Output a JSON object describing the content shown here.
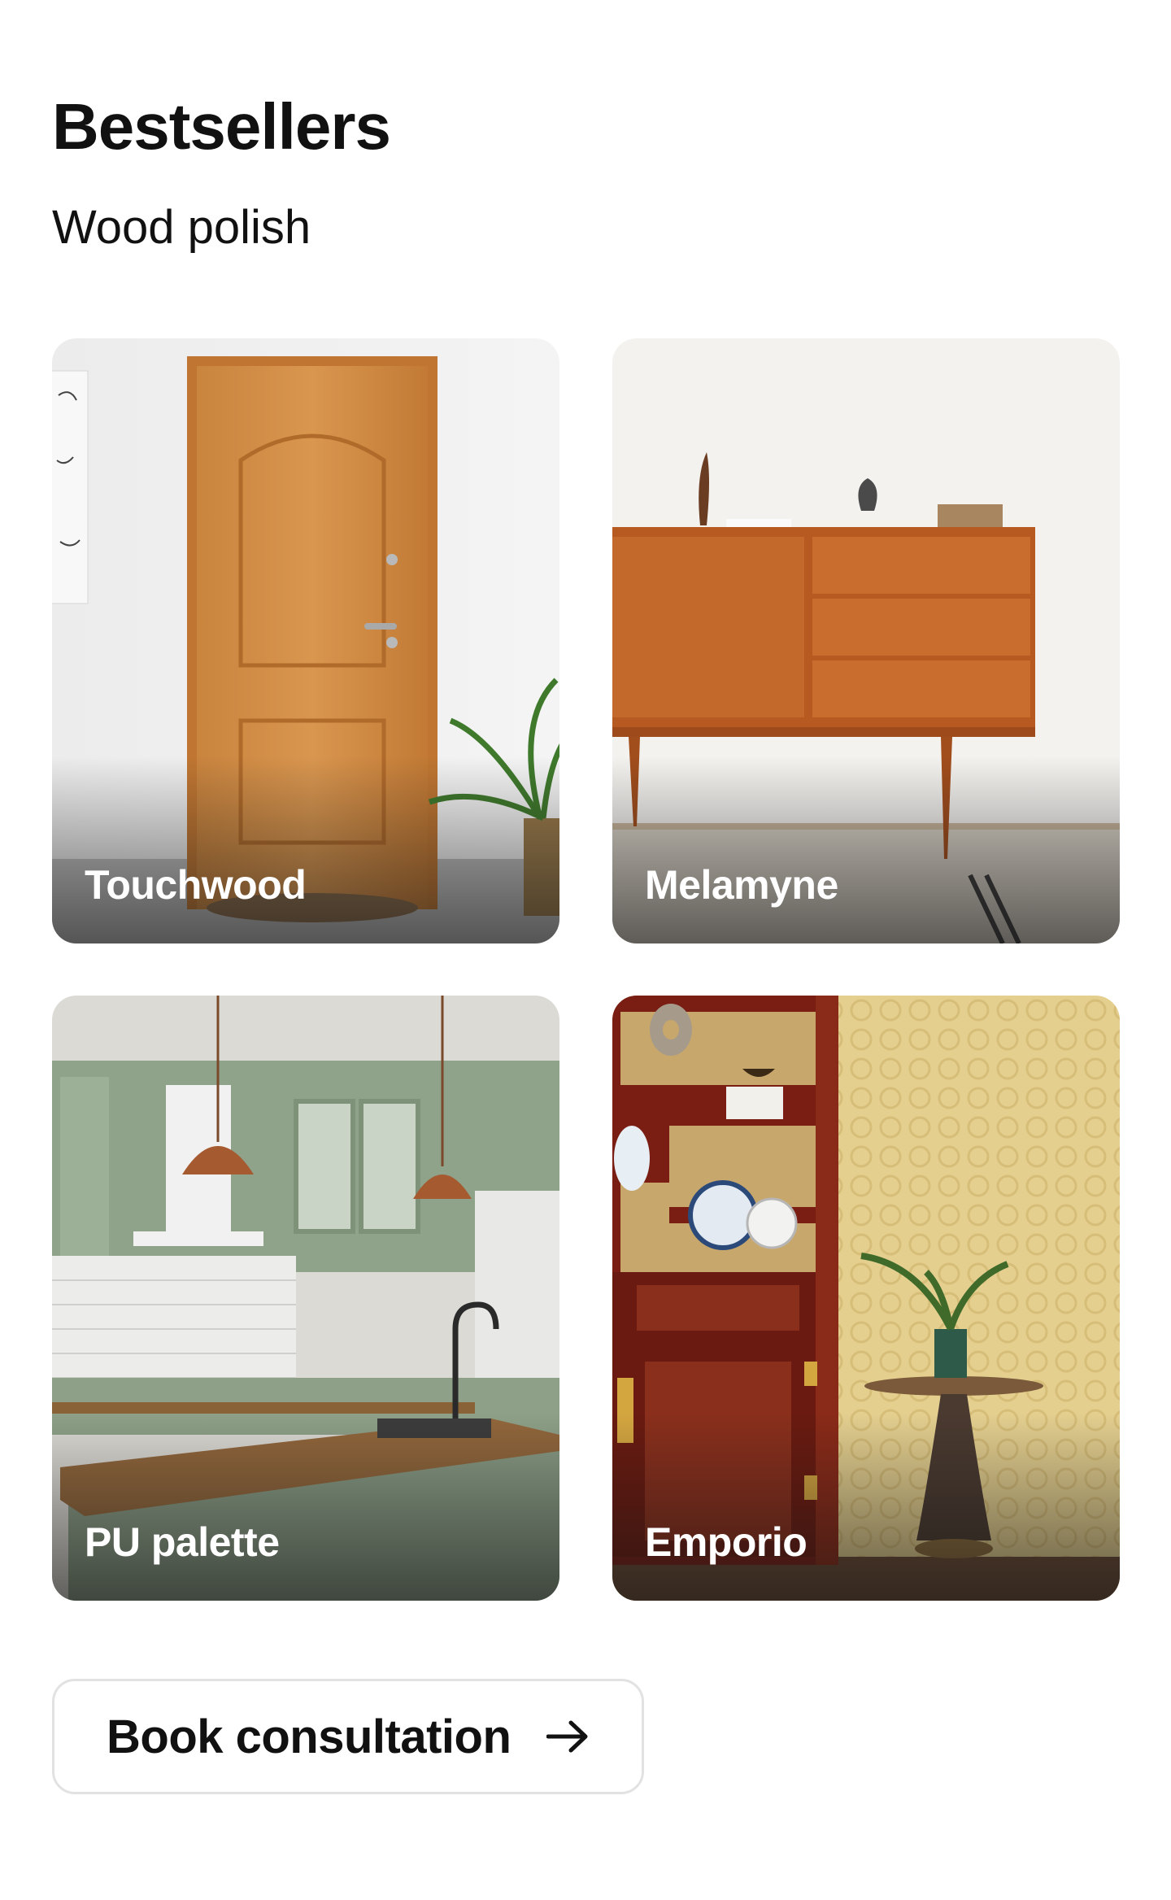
{
  "header": {
    "title": "Bestsellers",
    "subtitle": "Wood polish"
  },
  "products": [
    {
      "label": "Touchwood",
      "image": "wooden-door-scene"
    },
    {
      "label": "Melamyne",
      "image": "wooden-sideboard-scene"
    },
    {
      "label": "PU palette",
      "image": "green-kitchen-scene"
    },
    {
      "label": "Emporio",
      "image": "carved-cabinet-scene"
    }
  ],
  "cta": {
    "label": "Book consultation",
    "icon": "arrow-right-icon"
  },
  "colors": {
    "text": "#111111",
    "card_label": "#ffffff",
    "button_border": "#e2e2e2",
    "background": "#ffffff"
  }
}
